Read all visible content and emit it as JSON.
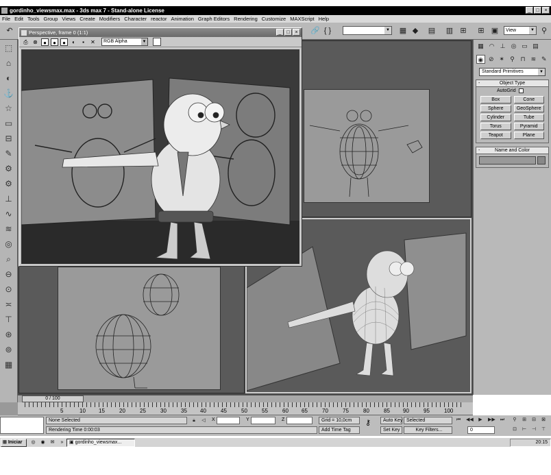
{
  "window": {
    "title": "gordinho_viewsmax.max - 3ds max 7 - Stand-alone License",
    "minimize": "_",
    "maximize": "□",
    "close": "×"
  },
  "menu": [
    "File",
    "Edit",
    "Tools",
    "Group",
    "Views",
    "Create",
    "Modifiers",
    "Character",
    "reactor",
    "Animation",
    "Graph Editors",
    "Rendering",
    "Customize",
    "MAXScript",
    "Help"
  ],
  "toolbar": {
    "undo_icon": "↶",
    "selection_dropdown": "",
    "view_dropdown": "View",
    "icons": [
      "🔗",
      "◆",
      "{ }",
      "⚲",
      "◇",
      "▦",
      "▤",
      "▥",
      "⊞",
      "▣"
    ]
  },
  "left_tools": [
    "⬚",
    "⌂",
    "◐",
    "⚓",
    "☆",
    "▭",
    "⊟",
    "✎",
    "⚙",
    "⚙",
    "⊥",
    "∿",
    "≋",
    "◎",
    "⌕",
    "⊖",
    "⊙",
    "≍",
    "⊤",
    "⊛",
    "⊚",
    "▦",
    "⊘",
    "▤"
  ],
  "render_frame": {
    "title": "Perspective, frame 0 (1:1)",
    "channel": "RGB Alpha",
    "tools": [
      "⎙",
      "⊗",
      "●",
      "●",
      "●",
      "◐",
      "▪",
      "✕"
    ],
    "minimize": "_",
    "maximize": "□",
    "close": "×"
  },
  "command_panel": {
    "tabs": [
      "▦",
      "◠",
      "⊥",
      "◎",
      "▭",
      "▤"
    ],
    "subtabs": [
      "◉",
      "⊘",
      "✶",
      "⚲",
      "⊓",
      "≋",
      "✎"
    ],
    "category": "Standard Primitives",
    "object_type": {
      "header": "Object Type",
      "autogrid": "AutoGrid",
      "buttons": [
        "Box",
        "Cone",
        "Sphere",
        "GeoSphere",
        "Cylinder",
        "Tube",
        "Torus",
        "Pyramid",
        "Teapot",
        "Plane"
      ]
    },
    "name_color": {
      "header": "Name and Color"
    }
  },
  "timeline": {
    "slider": "0 / 100",
    "ticks": [
      "5",
      "10",
      "15",
      "20",
      "25",
      "30",
      "35",
      "40",
      "45",
      "50",
      "55",
      "60",
      "65",
      "70",
      "75",
      "80",
      "85",
      "90",
      "95",
      "100"
    ]
  },
  "status": {
    "selection": "None Selected",
    "prompt": "Rendering Time 0:00:03",
    "x_label": "X",
    "y_label": "Y",
    "z_label": "Z",
    "grid": "Grid = 10,0cm",
    "add_time_tag": "Add Time Tag",
    "auto_key": "Auto Key",
    "set_key": "Set Key",
    "key_mode": "Selected",
    "key_filters": "Key Filters...",
    "frame": "0",
    "playback": [
      "⏮",
      "◀◀",
      "▶",
      "▶▶",
      "⏭"
    ],
    "nav": [
      "⚲",
      "⊞",
      "⊟",
      "⊠",
      "⊡",
      "⊢",
      "⊣",
      "⊤"
    ]
  },
  "taskbar": {
    "start": "Iniciar",
    "task": "gordinho_viewsmax...",
    "clock": "20:15",
    "quicklaunch": [
      "◎",
      "◉",
      "✉",
      "»"
    ]
  }
}
